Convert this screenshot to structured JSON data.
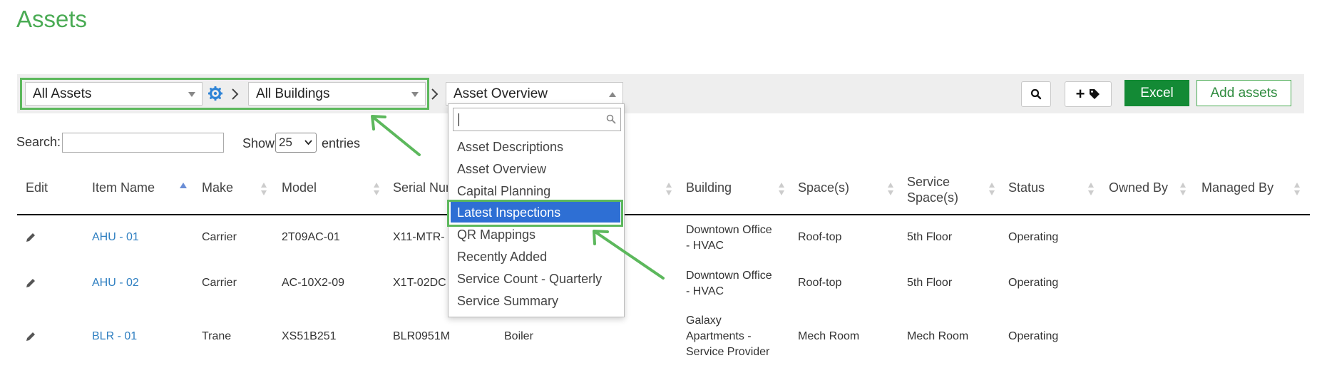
{
  "page": {
    "title": "Assets"
  },
  "toolbar": {
    "asset_filter": "All Assets",
    "building_filter": "All Buildings",
    "report_select": "Asset Overview",
    "excel_label": "Excel",
    "add_assets_label": "Add assets",
    "add_tag_label": "+"
  },
  "dropdown": {
    "items": [
      "Asset Descriptions",
      "Asset Overview",
      "Capital Planning",
      "Latest Inspections",
      "QR Mappings",
      "Recently Added",
      "Service Count - Quarterly",
      "Service Summary"
    ],
    "selected": "Latest Inspections"
  },
  "table_controls": {
    "search_label": "Search:",
    "show_label": "Show",
    "entries_value": "25",
    "entries_label": "entries"
  },
  "table": {
    "headers": {
      "edit": "Edit",
      "item_name": "Item Name",
      "make": "Make",
      "model": "Model",
      "serial": "Serial Nur",
      "building": "Building",
      "spaces": "Space(s)",
      "service_space_1": "Service",
      "service_space_2": "Space(s)",
      "status": "Status",
      "owned_by": "Owned By",
      "managed_by": "Managed By"
    },
    "rows": [
      {
        "item": "AHU - 01",
        "make": "Carrier",
        "model": "2T09AC-01",
        "serial": "X11-MTR-",
        "type": "",
        "building_1": "Downtown Office",
        "building_2": "- HVAC",
        "building_3": "",
        "space": "Roof-top",
        "service_space": "5th Floor",
        "status": "Operating"
      },
      {
        "item": "AHU - 02",
        "make": "Carrier",
        "model": "AC-10X2-09",
        "serial": "X1T-02DC",
        "type": "",
        "building_1": "Downtown Office",
        "building_2": "- HVAC",
        "building_3": "",
        "space": "Roof-top",
        "service_space": "5th Floor",
        "status": "Operating"
      },
      {
        "item": "BLR - 01",
        "make": "Trane",
        "model": "XS51B251",
        "serial": "BLR0951M",
        "type": "Boiler",
        "building_1": "Galaxy",
        "building_2": "Apartments -",
        "building_3": "Service Provider",
        "space": "Mech Room",
        "service_space": "Mech Room",
        "status": "Operating"
      }
    ]
  },
  "icons": {
    "gear": "gear-icon",
    "search": "search-icon",
    "tag": "tag-icon",
    "pencil": "pencil-icon"
  },
  "colors": {
    "title_green": "#4aab54",
    "excel_green": "#138a35",
    "link_blue": "#2f7fc1",
    "highlight_blue": "#2e6fd4",
    "annotation_green": "#5cb85c"
  }
}
